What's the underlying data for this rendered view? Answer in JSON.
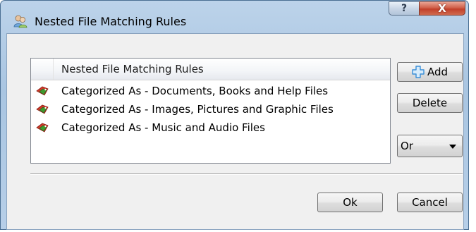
{
  "window": {
    "title": "Nested File Matching Rules",
    "help_glyph": "?",
    "close_glyph": "X"
  },
  "list": {
    "header": "Nested File Matching Rules",
    "rows": [
      {
        "label": "Categorized As - Documents, Books and Help Files",
        "icon": "category-tag-icon"
      },
      {
        "label": "Categorized As - Images, Pictures and Graphic Files",
        "icon": "category-tag-icon"
      },
      {
        "label": "Categorized As - Music and Audio Files",
        "icon": "category-tag-icon"
      }
    ]
  },
  "buttons": {
    "add": "Add",
    "delete": "Delete",
    "ok": "Ok",
    "cancel": "Cancel"
  },
  "operator_select": {
    "selected": "Or"
  },
  "colors": {
    "add_icon": "#3a8fd8",
    "close_button": "#c2402a",
    "tag_icon_red": "#d23a2a",
    "tag_icon_green": "#3f9a2e"
  }
}
